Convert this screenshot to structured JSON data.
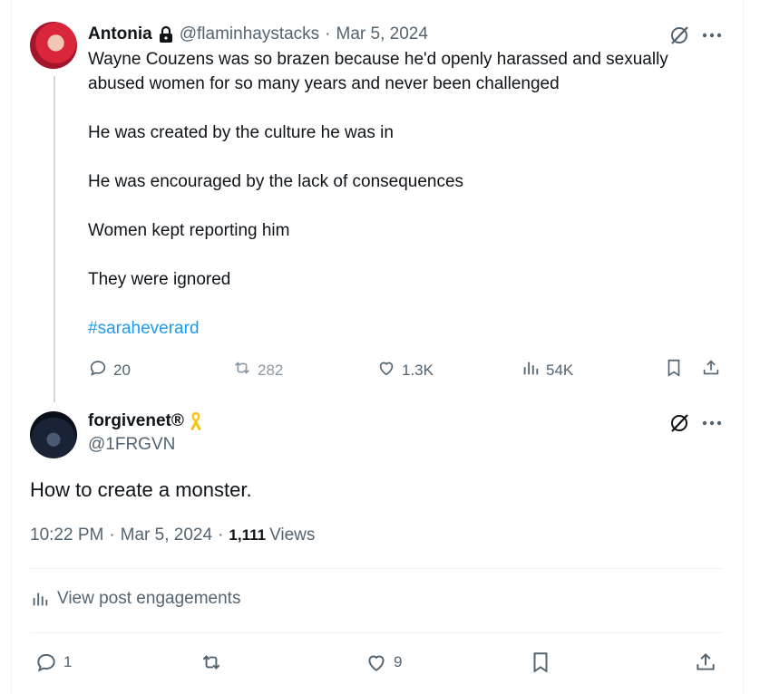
{
  "quoted_post": {
    "author_name": "Antonia",
    "handle": "@flaminhaystacks",
    "date": "Mar 5, 2024",
    "paragraphs": [
      "Wayne Couzens was so brazen because he'd openly harassed and sexually abused women for so many years and never been challenged",
      "He was created by the culture he was in",
      "He was encouraged by the lack of consequences",
      "Women kept reporting him",
      "They were ignored"
    ],
    "hashtag": "#saraheverard",
    "stats": {
      "replies": "20",
      "reposts": "282",
      "likes": "1.3K",
      "views": "54K"
    }
  },
  "main_post": {
    "author_name": "forgivenet®",
    "handle": "@1FRGVN",
    "text": "How to create a monster.",
    "time": "10:22 PM",
    "date": "Mar 5, 2024",
    "views_count": "1,111",
    "views_label": "Views",
    "engagements_label": "View post engagements",
    "stats": {
      "replies": "1",
      "likes": "9"
    }
  },
  "colors": {
    "accent": "#1d9bf0",
    "muted": "#536471",
    "text": "#0f1419",
    "ribbon": "#f5c518"
  },
  "icons": [
    "lock-icon",
    "grok-icon",
    "more-icon",
    "reply-icon",
    "repost-icon",
    "like-icon",
    "views-icon",
    "bookmark-icon",
    "share-icon",
    "ribbon-icon"
  ]
}
